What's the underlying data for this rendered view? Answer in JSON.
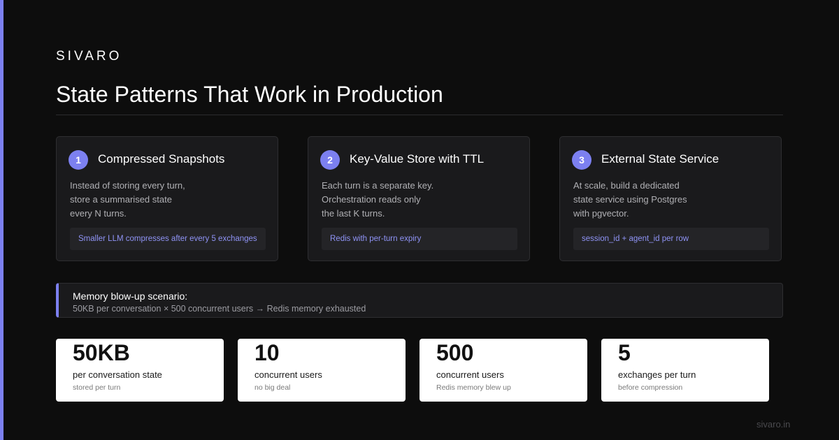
{
  "brand": "SIVARO",
  "title": "State Patterns That Work in Production",
  "colors": {
    "accent": "#7c80f0",
    "background": "#0d0d0d",
    "card": "#1a1a1c",
    "note_text": "#8f93f5"
  },
  "cards": [
    {
      "number": "1",
      "title": "Compressed Snapshots",
      "lines": [
        "Instead of storing every turn,",
        "store a summarised state",
        "every N turns."
      ],
      "note": "Smaller LLM compresses after every 5 exchanges"
    },
    {
      "number": "2",
      "title": "Key-Value Store with TTL",
      "lines": [
        "Each turn is a separate key.",
        "Orchestration reads only",
        "the last K turns."
      ],
      "note": "Redis with per-turn expiry"
    },
    {
      "number": "3",
      "title": "External State Service",
      "lines": [
        "At scale, build a dedicated",
        "state service using Postgres",
        "with pgvector."
      ],
      "note": "session_id + agent_id per row"
    }
  ],
  "callout": {
    "title": "Memory blow-up scenario:",
    "text": "50KB per conversation × 500 concurrent users → Redis memory exhausted"
  },
  "stats": [
    {
      "value": "50KB",
      "label": "per conversation state",
      "sub": "stored per turn"
    },
    {
      "value": "10",
      "label": "concurrent users",
      "sub": "no big deal"
    },
    {
      "value": "500",
      "label": "concurrent users",
      "sub": "Redis memory blew up"
    },
    {
      "value": "5",
      "label": "exchanges per turn",
      "sub": "before compression"
    }
  ],
  "footer": "sivaro.in"
}
